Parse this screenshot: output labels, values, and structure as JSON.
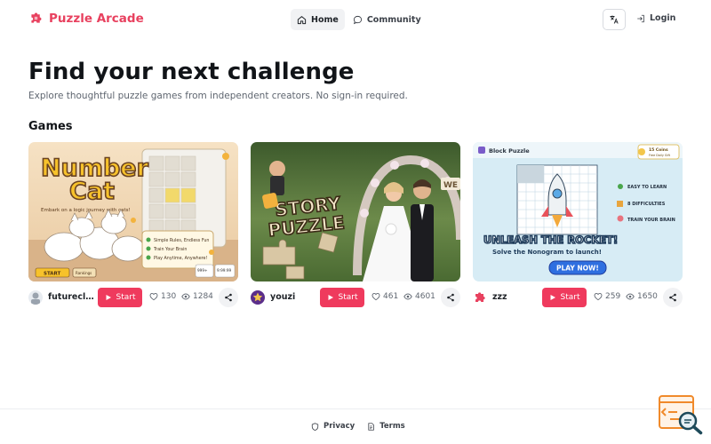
{
  "brand": {
    "name": "Puzzle Arcade",
    "icon": "puzzle-piece-icon",
    "color": "#e8415f"
  },
  "nav": {
    "items": [
      {
        "label": "Home",
        "icon": "home-icon",
        "active": true
      },
      {
        "label": "Community",
        "icon": "chat-bubble-icon",
        "active": false
      }
    ],
    "language_icon": "translate-icon",
    "login_label": "Login",
    "login_icon": "login-icon"
  },
  "hero": {
    "title": "Find your next challenge",
    "subtitle": "Explore thoughtful puzzle games from independent creators. No sign-in required."
  },
  "games_section": {
    "title": "Games"
  },
  "games": [
    {
      "thumb": {
        "title_line1": "Number",
        "title_line2": "Cat",
        "tagline": "Embark on a logic journey with cats!",
        "features": [
          "Simple Rules, Endless Fun",
          "Train Your Brain",
          "Play Anytime, Anywhere!"
        ],
        "badge_left": "START",
        "badge_left2": "Rankings",
        "badge_right": "999+",
        "badge_right2": "9:99:99"
      },
      "author": "futurecl...",
      "start_label": "Start",
      "likes": "130",
      "views": "1284"
    },
    {
      "thumb": {
        "title_line1": "STORY",
        "title_line2": "PUZZLE",
        "sign": "WE"
      },
      "author": "youzi",
      "start_label": "Start",
      "likes": "461",
      "views": "4601"
    },
    {
      "thumb": {
        "header": "Block Puzzle",
        "coins": "15 Coins",
        "coins_sub": "Free Daily Gift",
        "features": [
          "EASY TO LEARN",
          "8 DIFFICULTIES",
          "TRAIN YOUR BRAIN"
        ],
        "headline": "UNLEASH THE ROCKET!",
        "subline": "Solve the Nonogram to launch!",
        "cta": "PLAY NOW!"
      },
      "author": "zzz",
      "start_label": "Start",
      "likes": "259",
      "views": "1650"
    }
  ],
  "footer": {
    "links": [
      {
        "label": "Privacy",
        "icon": "shield-icon"
      },
      {
        "label": "Terms",
        "icon": "document-icon"
      }
    ]
  },
  "widget": {
    "icon": "code-search-icon"
  },
  "colors": {
    "accent": "#ef3a5d",
    "text": "#1f2328",
    "muted": "#5f6670"
  }
}
